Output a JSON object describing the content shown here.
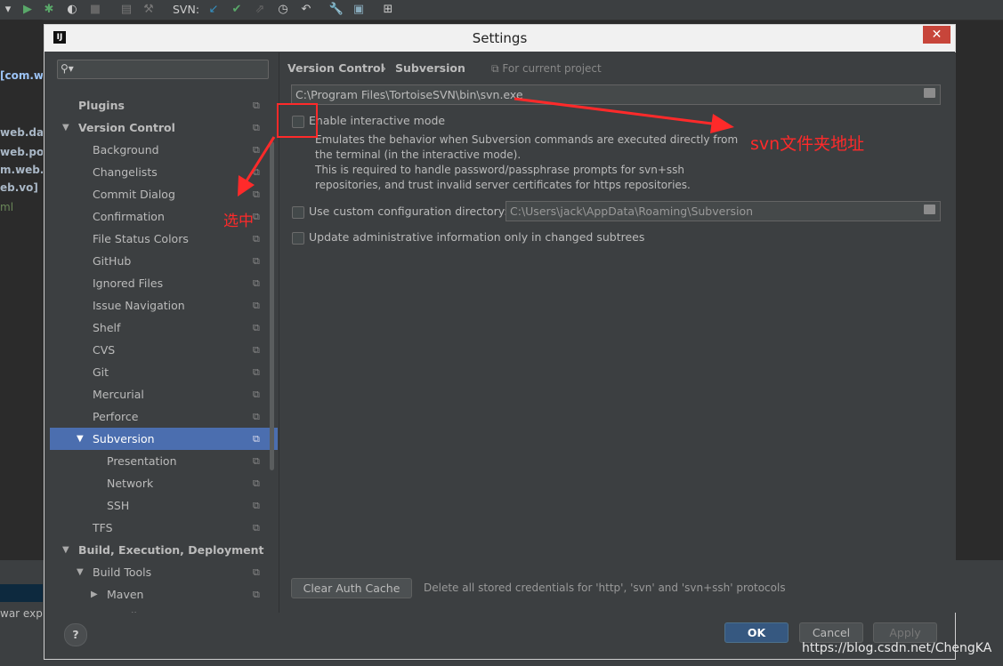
{
  "ide": {
    "toolbar_svn_label": "SVN:",
    "left_packages": [
      "[com.wi",
      "web.dao",
      "web.poj",
      "m.web.s",
      "eb.vo]",
      "ml"
    ],
    "bottom_text": "war exp"
  },
  "dialog": {
    "title": "Settings",
    "logo_text": "IJ",
    "close_label": "✕",
    "sidebar": {
      "search_placeholder": "",
      "items": [
        {
          "label": "Plugins"
        },
        {
          "label": "Version Control"
        },
        {
          "label": "Background"
        },
        {
          "label": "Changelists"
        },
        {
          "label": "Commit Dialog"
        },
        {
          "label": "Confirmation"
        },
        {
          "label": "File Status Colors"
        },
        {
          "label": "GitHub"
        },
        {
          "label": "Ignored Files"
        },
        {
          "label": "Issue Navigation"
        },
        {
          "label": "Shelf"
        },
        {
          "label": "CVS"
        },
        {
          "label": "Git"
        },
        {
          "label": "Mercurial"
        },
        {
          "label": "Perforce"
        },
        {
          "label": "Subversion"
        },
        {
          "label": "Presentation"
        },
        {
          "label": "Network"
        },
        {
          "label": "SSH"
        },
        {
          "label": "TFS"
        },
        {
          "label": "Build, Execution, Deployment"
        },
        {
          "label": "Build Tools"
        },
        {
          "label": "Maven"
        },
        {
          "label": "Gradle"
        }
      ]
    },
    "content": {
      "breadcrumb_parent": "Version Control",
      "breadcrumb_sep": "›",
      "breadcrumb_current": "Subversion",
      "scope_label": "For current project",
      "svn_path": "C:\\Program Files\\TortoiseSVN\\bin\\svn.exe",
      "interactive_mode_label": "Enable interactive mode",
      "interactive_desc": [
        "Emulates the behavior when Subversion commands are executed directly from",
        "the terminal (in the interactive mode).",
        "This is required to handle password/passphrase prompts for svn+ssh",
        "repositories, and trust invalid server certificates for https repositories."
      ],
      "custom_config_label": "Use custom configuration directory:",
      "config_dir": "C:\\Users\\jack\\AppData\\Roaming\\Subversion",
      "update_admin_label": "Update administrative information only in changed subtrees",
      "clear_auth_label": "Clear Auth Cache",
      "clear_auth_desc": "Delete all stored credentials for 'http', 'svn' and 'svn+ssh' protocols"
    },
    "buttons": {
      "ok": "OK",
      "cancel": "Cancel",
      "apply": "Apply",
      "help": "?"
    }
  },
  "annotations": {
    "svn_folder_note": "svn文件夹地址",
    "select_note": "选中",
    "color": "#ff2a2a"
  },
  "watermark": "https://blog.csdn.net/ChengKA"
}
